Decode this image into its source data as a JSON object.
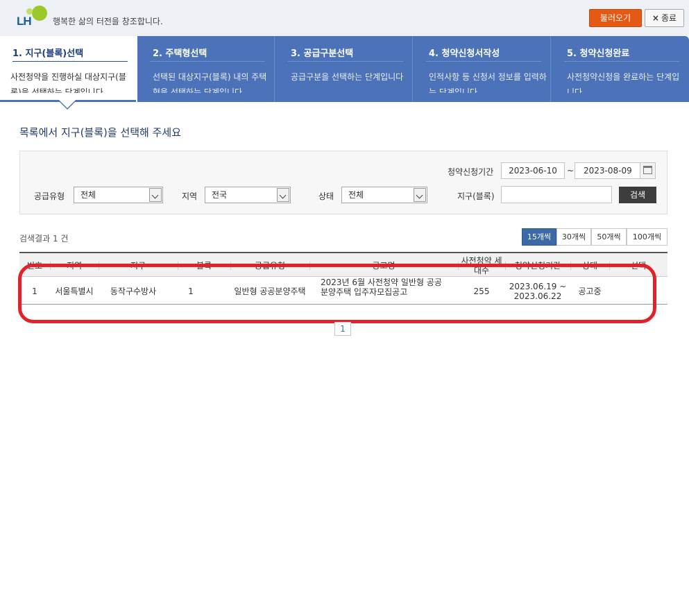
{
  "header": {
    "logo_text": "LH",
    "slogan": "행복한 삶의 터전을 창조합니다.",
    "load_button": "불러오기",
    "close_button": "종료",
    "close_icon": "×"
  },
  "steps": [
    {
      "title": "1. 지구(블록)선택",
      "desc": "사전청약을 진행하실 대상지구(블록)을 선택하는 단계입니다"
    },
    {
      "title": "2. 주택형선택",
      "desc": "선택된 대상지구(블록) 내의 주택형을 선택하는 단계입니다"
    },
    {
      "title": "3. 공급구분선택",
      "desc": "공급구분을 선택하는 단계입니다"
    },
    {
      "title": "4. 청약신청서작성",
      "desc": "인적사항 등 신청서 정보를 입력하는 단계입니다"
    },
    {
      "title": "5. 청약신청완료",
      "desc": "사전청약신청을 완료하는 단계입니다"
    }
  ],
  "page_heading": "목록에서 지구(블록)을 선택해 주세요",
  "filters": {
    "period_label": "청약신청기간",
    "date_from": "2023-06-10",
    "date_to": "2023-08-09",
    "tilde": "~",
    "supply_type_label": "공급유형",
    "supply_type_value": "전체",
    "region_label": "지역",
    "region_value": "전국",
    "status_label": "상태",
    "status_value": "전체",
    "district_label": "지구(블록)",
    "district_value": "",
    "search_button": "검색"
  },
  "results": {
    "count_text": "검색결과 1 건",
    "page_sizes": [
      "15개씩",
      "30개씩",
      "50개씩",
      "100개씩"
    ],
    "selected_page_size": "15개씩"
  },
  "table": {
    "headers": [
      "번호",
      "지역",
      "지구",
      "블록",
      "공급유형",
      "공고명",
      "사전청약 세대수",
      "청약신청기간",
      "상태",
      "선택"
    ],
    "rows": [
      {
        "no": "1",
        "region": "서울특별시",
        "district": "동작구수방사",
        "block": "1",
        "supply_type": "일반형 공공분양주택",
        "notice_line1": "2023년 6월 사전청약 일반형 공공",
        "notice_line2": "분양주택 입주자모집공고",
        "units": "255",
        "period_line1": "2023.06.19 ~",
        "period_line2": "2023.06.22",
        "status": "공고중",
        "select": ""
      }
    ]
  },
  "pagination": {
    "current_page": "1"
  },
  "colors": {
    "brand_blue": "#4c72b9",
    "accent_orange": "#e45a14",
    "highlight_red": "#e2222a",
    "page_size_selected": "#3b6aa6"
  }
}
